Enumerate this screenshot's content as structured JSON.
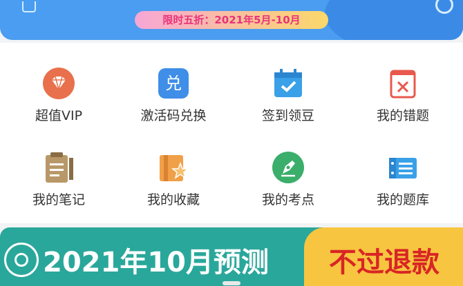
{
  "promo": {
    "text": "限时五折：2021年5月-10月"
  },
  "grid": {
    "items": [
      {
        "label": "超值VIP",
        "icon": "diamond-icon",
        "color": "#e8704c"
      },
      {
        "label": "激活码兑换",
        "icon": "exchange-icon",
        "color": "#3f8ee8"
      },
      {
        "label": "签到领豆",
        "icon": "calendar-check-icon",
        "color": "#3aa0e8"
      },
      {
        "label": "我的错题",
        "icon": "wrong-book-icon",
        "color": "#e8584c"
      },
      {
        "label": "我的笔记",
        "icon": "clipboard-icon",
        "color": "#b89868"
      },
      {
        "label": "我的收藏",
        "icon": "star-folder-icon",
        "color": "#f0a048"
      },
      {
        "label": "我的考点",
        "icon": "pen-icon",
        "color": "#3aae6a"
      },
      {
        "label": "我的题库",
        "icon": "question-bank-icon",
        "color": "#3aa0e8"
      }
    ]
  },
  "banner": {
    "left_text": "2021年10月预测",
    "right_text": "不过退款"
  },
  "exchange_glyph": "兑"
}
